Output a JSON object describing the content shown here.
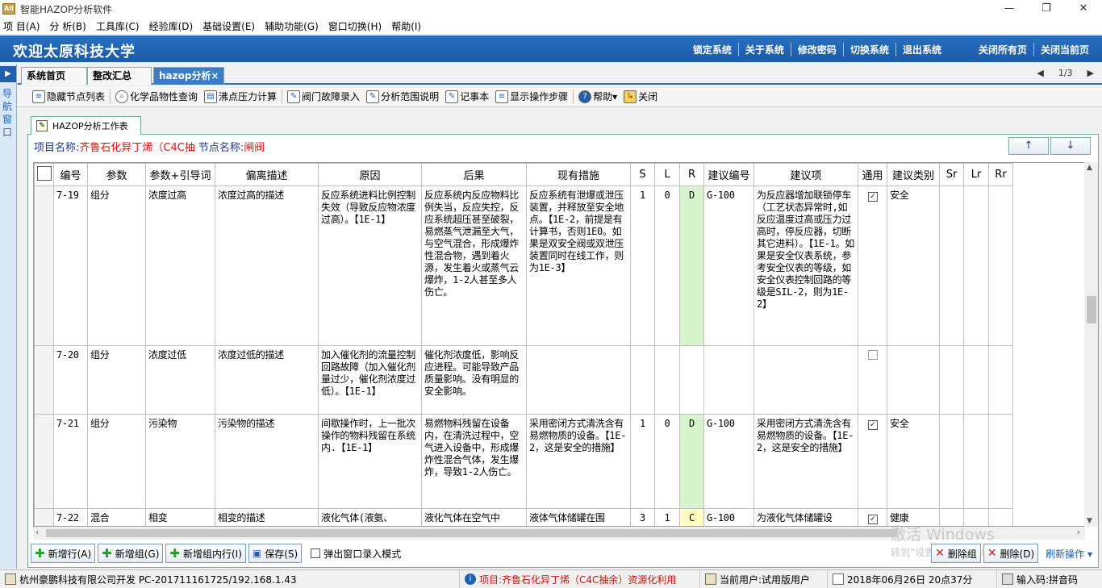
{
  "window": {
    "title": "智能HAZOP分析软件",
    "logo_text": "Ail",
    "minimize": "—",
    "restore": "❐",
    "close": "✕"
  },
  "menu": [
    "项 目(A)",
    "分 析(B)",
    "工具库(C)",
    "经验库(D)",
    "基础设置(E)",
    "辅助功能(G)",
    "窗口切换(H)",
    "帮助(I)"
  ],
  "banner": {
    "welcome": "欢迎太原科技大学",
    "links": [
      "锁定系统",
      "关于系统",
      "修改密码",
      "切换系统",
      "退出系统"
    ],
    "right_links": [
      "关闭所有页",
      "关闭当前页"
    ]
  },
  "leftnav": {
    "label": "导航窗口",
    "arrow": "▶"
  },
  "tabs": [
    {
      "label": "系统首页"
    },
    {
      "label": "整改汇总"
    },
    {
      "label": "hazop分析×"
    }
  ],
  "pager": {
    "prev": "◀",
    "text": "1/3",
    "next": "▶"
  },
  "toolbar": [
    {
      "label": "隐藏节点列表",
      "icon": "list-icon"
    },
    {
      "label": "化学品物性查询",
      "icon": "search-icon"
    },
    {
      "label": "沸点压力计算",
      "icon": "document-icon"
    },
    {
      "label": "阀门故障录入",
      "icon": "valve-icon"
    },
    {
      "label": "分析范围说明",
      "icon": "note-icon"
    },
    {
      "label": "记事本",
      "icon": "notepad-icon"
    },
    {
      "label": "显示操作步骤",
      "icon": "steps-icon"
    },
    {
      "label": "帮助▾",
      "icon": "help-icon"
    },
    {
      "label": "关闭",
      "icon": "close-icon"
    }
  ],
  "worktab": {
    "label": "HAZOP分析工作表"
  },
  "project": {
    "name_label": "项目名称:",
    "name_value": "齐鲁石化异丁烯（C4C抽",
    "node_label": "节点名称:",
    "node_value": "闸阀"
  },
  "nav_buttons": {
    "up": "↑",
    "down": "↓"
  },
  "grid": {
    "headers": [
      "",
      "编号",
      "参数",
      "参数+引导词",
      "偏离描述",
      "原因",
      "后果",
      "现有措施",
      "S",
      "L",
      "R",
      "建议编号",
      "建议项",
      "通用",
      "建议类别",
      "Sr",
      "Lr",
      "Rr"
    ],
    "rows": [
      {
        "id": "7-19",
        "param": "组分",
        "guide": "浓度过高",
        "deviation": "浓度过高的描述",
        "cause": "反应系统进料比例控制失效（导致反应物浓度过高）。【1E-1】",
        "consequence": "反应系统内反应物料比例失当，反应失控，反应系统超压甚至破裂，易燃蒸气泄漏至大气，与空气混合，形成爆炸性混合物，遇到着火源，发生着火或蒸气云爆炸，1-2人甚至多人伤亡。",
        "measures": "反应系统有泄爆或泄压装置，并释放至安全地点。【1E-2，前提是有计算书，否则1E0。如果是双安全阀或双泄压装置同时在线工作，则为1E-3】",
        "S": "1",
        "L": "0",
        "R": "D",
        "r_color": "green",
        "sug_no": "G-100",
        "suggestion": "为反应器增加联锁停车（工艺状态异常时,如反应温度过高或压力过高时，停反应器，切断其它进料）。【1E-1。如果是安全仪表系统，参考安全仪表的等级，如安全仪表控制回路的等级是SIL-2，则为1E-2】",
        "common": "✓",
        "category": "安全",
        "Sr": "",
        "Lr": "",
        "Rr": ""
      },
      {
        "id": "7-20",
        "param": "组分",
        "guide": "浓度过低",
        "deviation": "浓度过低的描述",
        "cause": "加入催化剂的流量控制回路故障（加入催化剂量过少，催化剂浓度过低）。【1E-1】",
        "consequence": "催化剂浓度低，影响反应进程。可能导致产品质量影响。没有明显的安全影响。",
        "measures": "",
        "S": "",
        "L": "",
        "R": "",
        "r_color": "",
        "sug_no": "",
        "suggestion": "",
        "common": "",
        "category": "",
        "Sr": "",
        "Lr": "",
        "Rr": ""
      },
      {
        "id": "7-21",
        "param": "组分",
        "guide": "污染物",
        "deviation": "污染物的描述",
        "cause": "间歇操作时，上一批次操作的物料残留在系统内.【1E-1】",
        "consequence": "易燃物料残留在设备内，在清洗过程中，空气进入设备中，形成爆炸性混合气体，发生爆炸，导致1-2人伤亡。",
        "measures": "采用密闭方式清洗含有易燃物质的设备。【1E-2，这是安全的措施】",
        "S": "1",
        "L": "0",
        "R": "D",
        "r_color": "green",
        "sug_no": "G-100",
        "suggestion": "采用密闭方式清洗含有易燃物质的设备。【1E-2，这是安全的措施】",
        "common": "✓",
        "category": "安全",
        "Sr": "",
        "Lr": "",
        "Rr": ""
      },
      {
        "id": "7-22",
        "param": "混合",
        "guide": "相变",
        "deviation": "相变的描述",
        "cause": "液化气体(液氨、",
        "consequence": "液化气体在空气中",
        "measures": "液体气体储罐在围",
        "S": "3",
        "L": "1",
        "R": "C",
        "r_color": "yellow",
        "sug_no": "G-100",
        "suggestion": "为液化气体储罐设",
        "common": "✓",
        "category": "健康",
        "Sr": "",
        "Lr": "",
        "Rr": ""
      }
    ]
  },
  "bottom_buttons": [
    "新增行(A)",
    "新增组(G)",
    "新增组内行(I)",
    "保存(S)"
  ],
  "popup_checkbox": "弹出窗口录入模式",
  "delete_buttons": [
    "删除组",
    "删除(D)"
  ],
  "more_ops": "刷新操作 ▾",
  "watermark": {
    "line1": "激活 Windows",
    "line2": "转到“设置”以激活 Windows。"
  },
  "status": {
    "company": "杭州豪鹏科技有限公司开发  PC-201711161725/192.168.1.43",
    "project": "项目:齐鲁石化异丁烯（C4C抽余）资源化利用",
    "user": "当前用户:试用版用户",
    "date": "2018年06月26日 20点37分",
    "ime": "输入码:拼音码"
  }
}
